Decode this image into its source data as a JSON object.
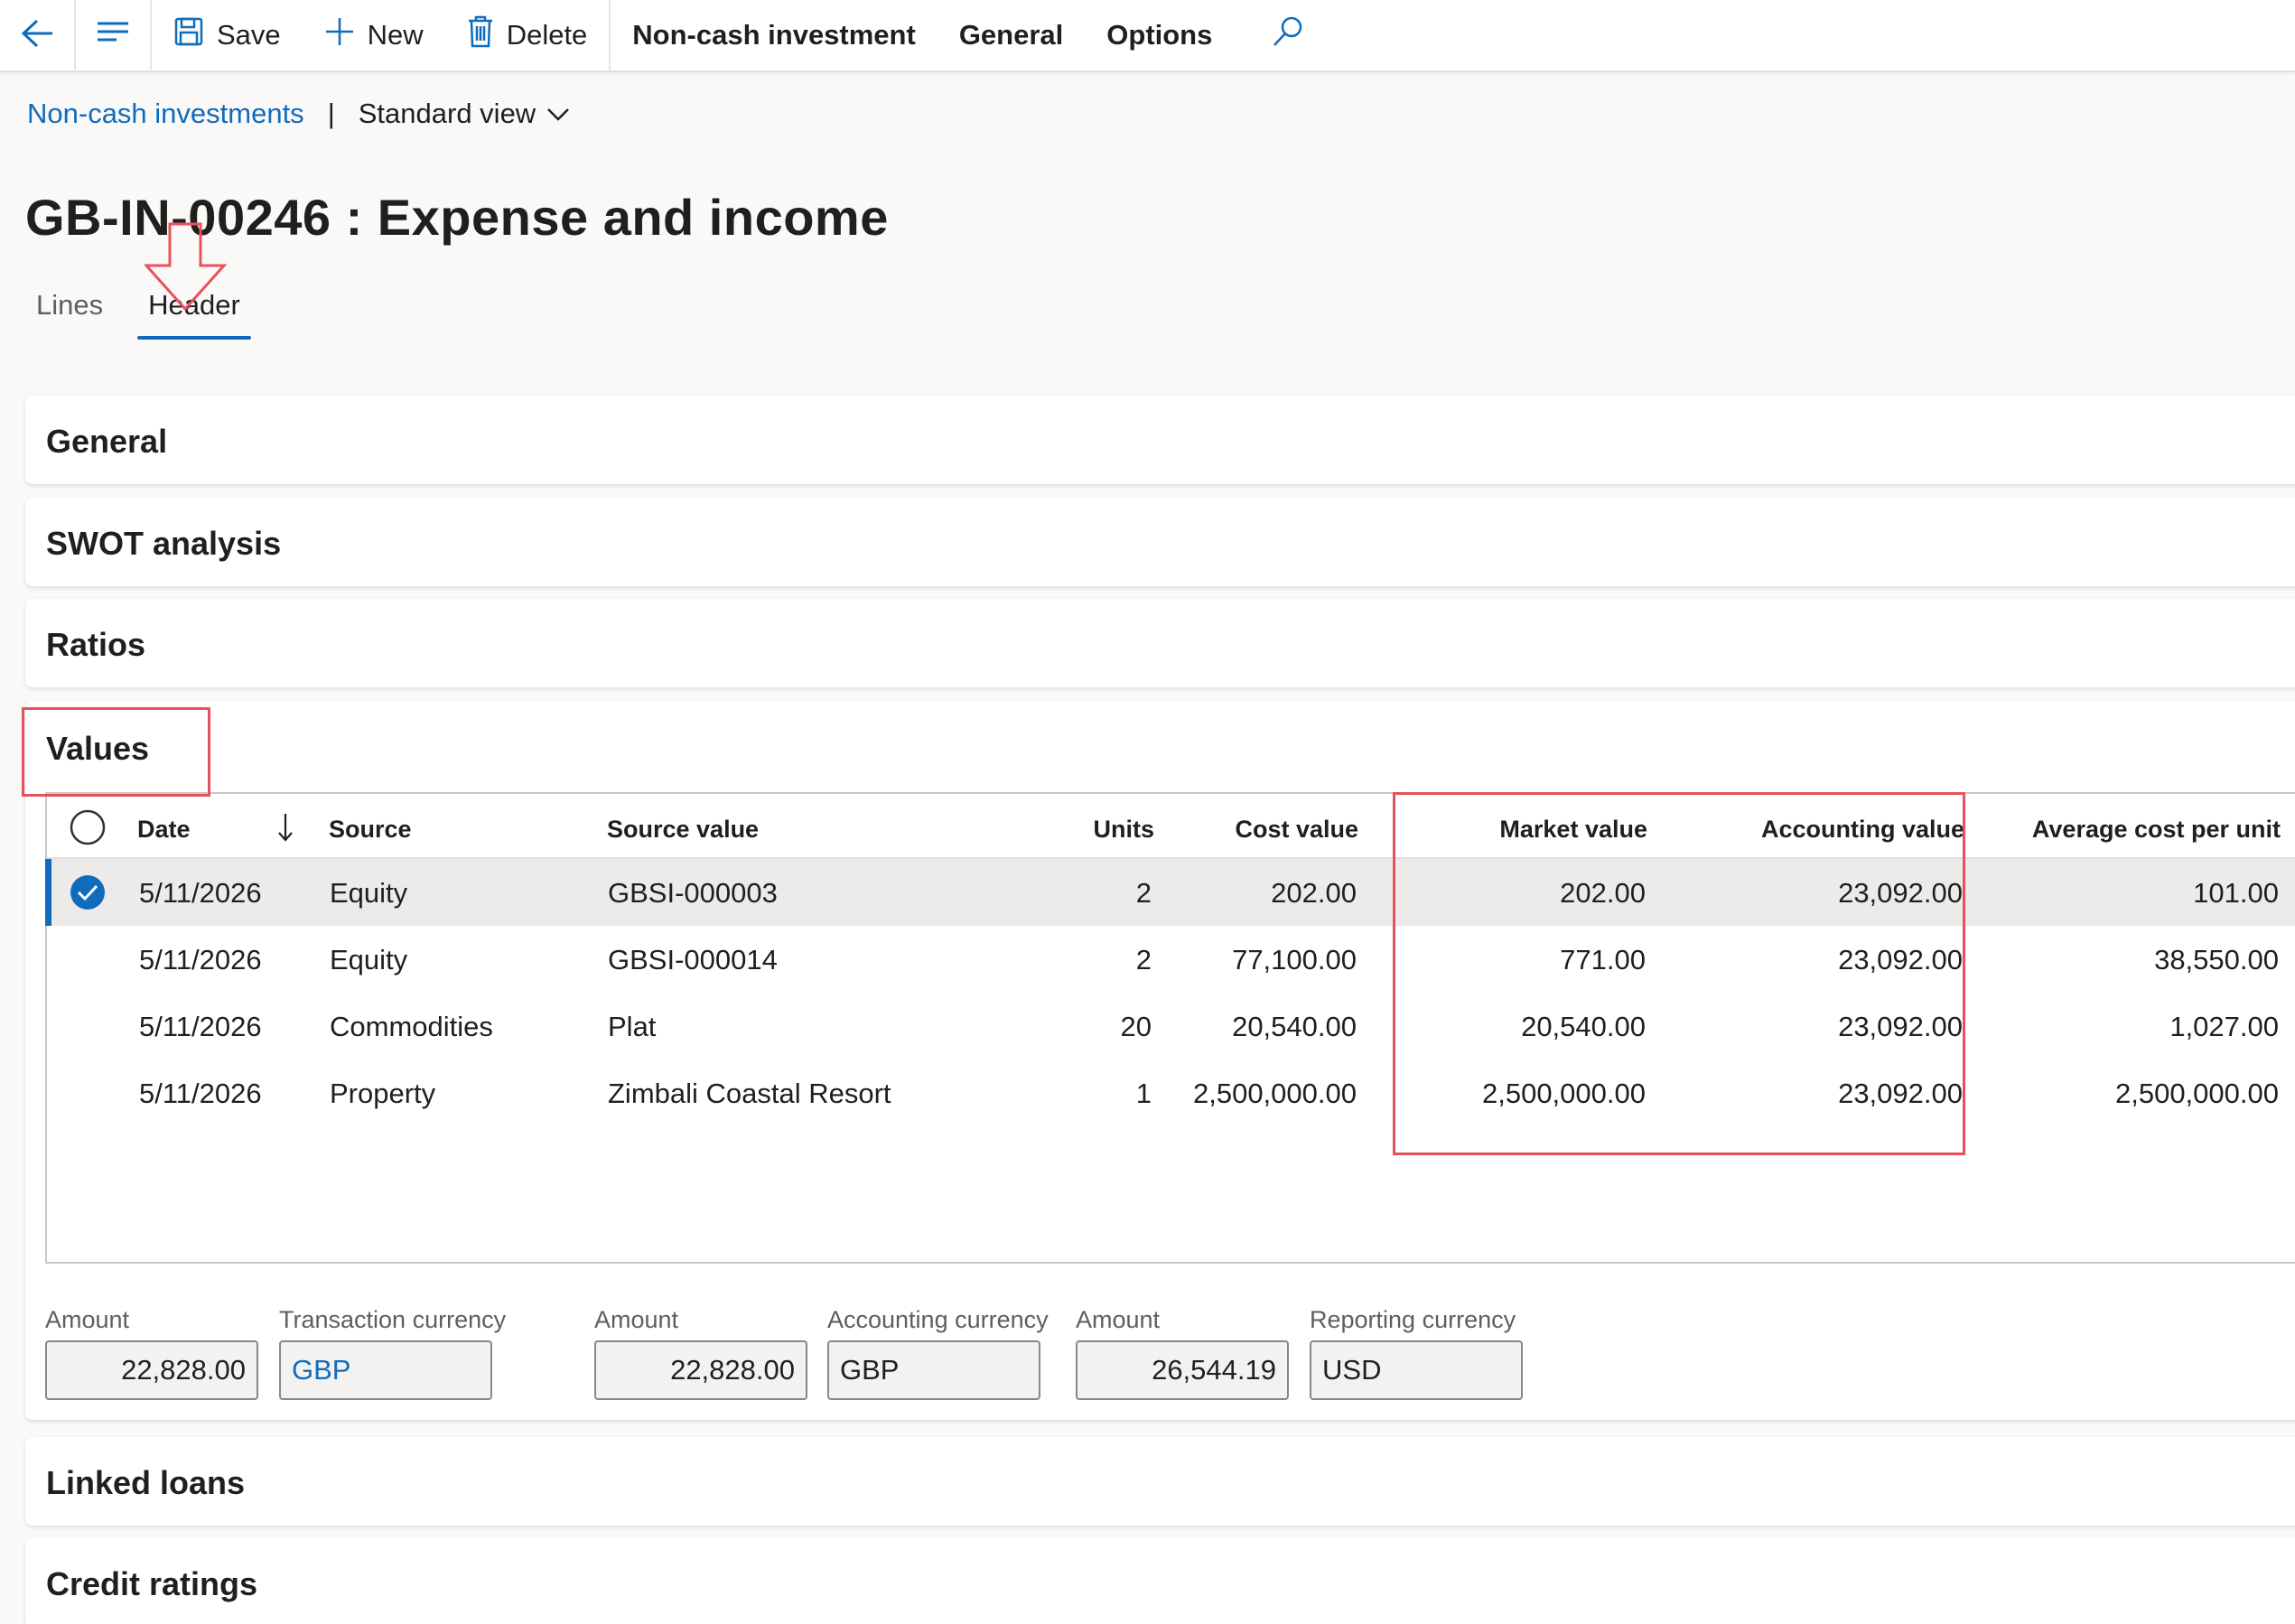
{
  "toolbar": {
    "save_label": "Save",
    "new_label": "New",
    "delete_label": "Delete",
    "menu_noncash": "Non-cash investment",
    "menu_general": "General",
    "menu_options": "Options",
    "icons": [
      "back-arrow-icon",
      "menu-lines-icon",
      "save-icon",
      "plus-icon",
      "trash-icon",
      "search-icon"
    ]
  },
  "breadcrumb": {
    "link": "Non-cash investments",
    "divider": "|",
    "view": "Standard view"
  },
  "page_title": "GB-IN-00246 : Expense and income",
  "tabs": {
    "lines": "Lines",
    "header": "Header"
  },
  "sections": {
    "general": "General",
    "swot": "SWOT analysis",
    "ratios": "Ratios",
    "values": "Values",
    "linked_loans": "Linked loans",
    "credit_ratings": "Credit ratings"
  },
  "grid": {
    "columns": {
      "date": "Date",
      "source": "Source",
      "source_value": "Source value",
      "units": "Units",
      "cost_value": "Cost value",
      "market_value": "Market value",
      "accounting_value": "Accounting value",
      "avg_cost": "Average cost per unit"
    },
    "rows": [
      {
        "date": "5/11/2026",
        "source": "Equity",
        "source_value": "GBSI-000003",
        "units": "2",
        "cost_value": "202.00",
        "market_value": "202.00",
        "accounting_value": "23,092.00",
        "avg_cost": "101.00"
      },
      {
        "date": "5/11/2026",
        "source": "Equity",
        "source_value": "GBSI-000014",
        "units": "2",
        "cost_value": "77,100.00",
        "market_value": "771.00",
        "accounting_value": "23,092.00",
        "avg_cost": "38,550.00"
      },
      {
        "date": "5/11/2026",
        "source": "Commodities",
        "source_value": "Plat",
        "units": "20",
        "cost_value": "20,540.00",
        "market_value": "20,540.00",
        "accounting_value": "23,092.00",
        "avg_cost": "1,027.00"
      },
      {
        "date": "5/11/2026",
        "source": "Property",
        "source_value": "Zimbali Coastal Resort",
        "units": "1",
        "cost_value": "2,500,000.00",
        "market_value": "2,500,000.00",
        "accounting_value": "23,092.00",
        "avg_cost": "2,500,000.00"
      }
    ]
  },
  "totals": {
    "amount1_label": "Amount",
    "amount1_value": "22,828.00",
    "trans_currency_label": "Transaction currency",
    "trans_currency_value": "GBP",
    "amount2_label": "Amount",
    "amount2_value": "22,828.00",
    "acct_currency_label": "Accounting currency",
    "acct_currency_value": "GBP",
    "amount3_label": "Amount",
    "amount3_value": "26,544.19",
    "rep_currency_label": "Reporting currency",
    "rep_currency_value": "USD"
  },
  "colors": {
    "accent": "#0f6cbd",
    "annotation": "#e8515c"
  }
}
